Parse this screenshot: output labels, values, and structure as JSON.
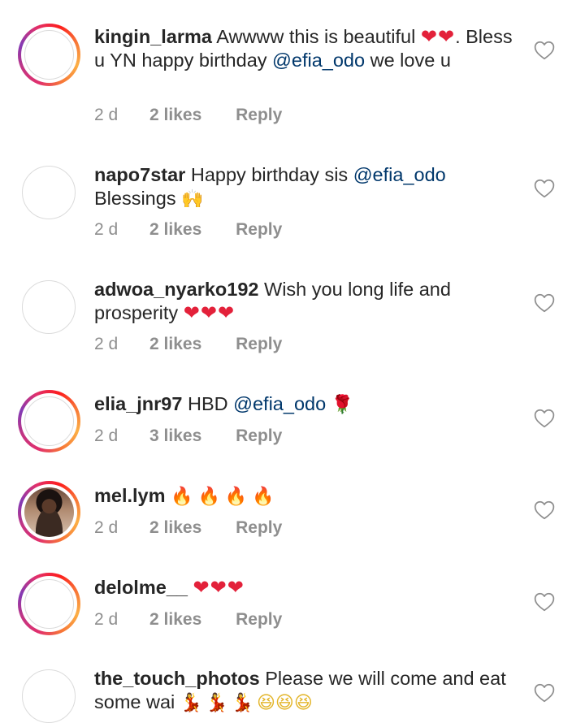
{
  "comments": [
    {
      "username": "kingin_larma",
      "text_before": "Awwww this is beautiful ",
      "emoji": "❤❤",
      "text_after_emoji": ". Bless u YN happy birthday ",
      "mention": "@efia_odo",
      "text_end": "  we love u",
      "time": "2 d",
      "likes": "2 likes",
      "reply": "Reply",
      "avatar": "story-ring"
    },
    {
      "username": "napo7star",
      "text_before": "Happy birthday sis ",
      "mention": "@efia_odo",
      "text_after": " Blessings ",
      "emoji": "🙌",
      "time": "2 d",
      "likes": "2 likes",
      "reply": "Reply",
      "avatar": "plain"
    },
    {
      "username": "adwoa_nyarko192",
      "text": "Wish you long life and prosperity ",
      "emoji": "❤❤❤",
      "time": "2 d",
      "likes": "2 likes",
      "reply": "Reply",
      "avatar": "plain"
    },
    {
      "username": "elia_jnr97",
      "text_before": "HBD ",
      "mention": "@efia_odo",
      "emoji": "🌹",
      "time": "2 d",
      "likes": "3 likes",
      "reply": "Reply",
      "avatar": "story-ring"
    },
    {
      "username": "mel.lym",
      "emoji": "🔥🔥🔥🔥",
      "time": "2 d",
      "likes": "2 likes",
      "reply": "Reply",
      "avatar": "story-ring-photo"
    },
    {
      "username": "delolme__",
      "emoji": "❤❤❤",
      "time": "2 d",
      "likes": "2 likes",
      "reply": "Reply",
      "avatar": "story-ring"
    },
    {
      "username": "the_touch_photos",
      "text": "Please we will come and eat some wai ",
      "emoji_a": "💃💃💃",
      "emoji_b": "😆😆😆",
      "avatar": "plain"
    }
  ],
  "icons": {
    "like": "heart-outline-icon"
  },
  "colors": {
    "username": "#262626",
    "mention": "#00376b",
    "meta": "#8e8e8e",
    "heart_outline": "#8e8e8e"
  }
}
